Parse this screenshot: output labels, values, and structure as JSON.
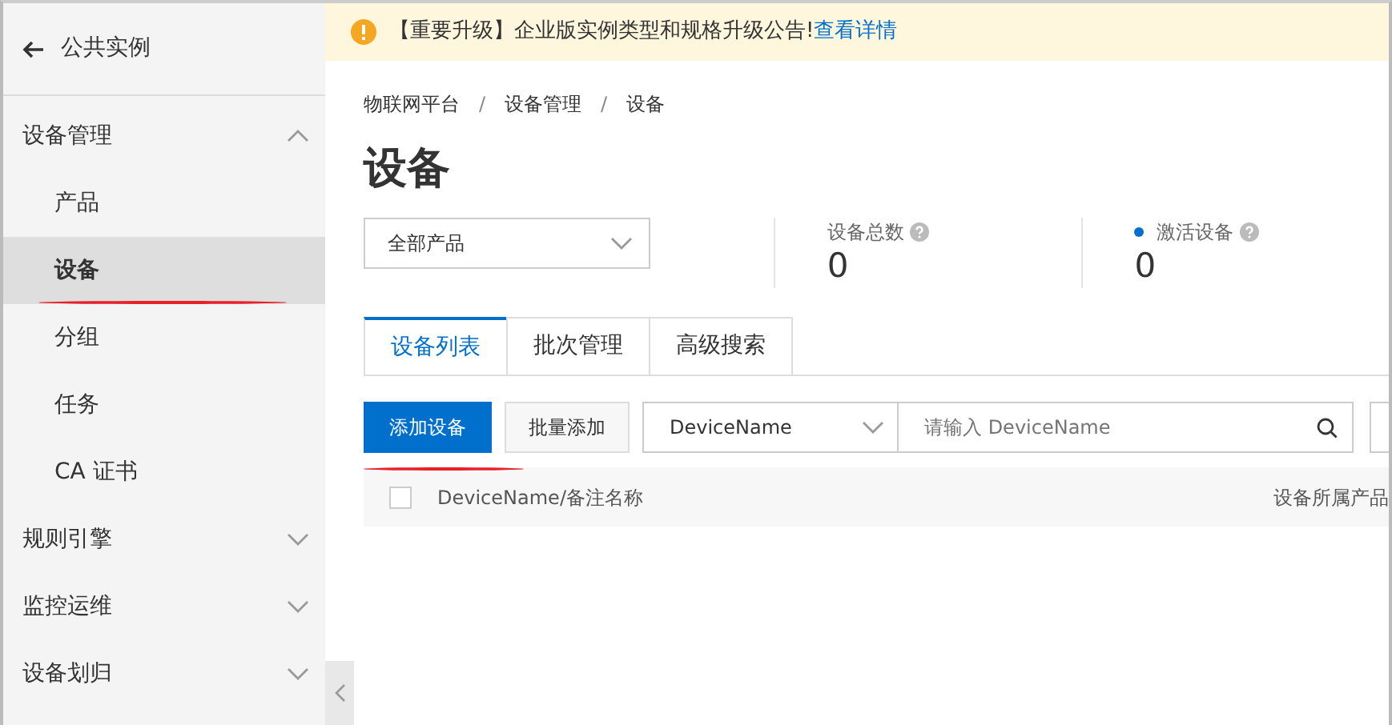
{
  "sidebar": {
    "back_label": "公共实例",
    "sections": [
      {
        "label": "设备管理",
        "expanded": true,
        "items": [
          {
            "label": "产品",
            "selected": false
          },
          {
            "label": "设备",
            "selected": true
          },
          {
            "label": "分组",
            "selected": false
          },
          {
            "label": "任务",
            "selected": false
          },
          {
            "label": "CA 证书",
            "selected": false
          }
        ]
      },
      {
        "label": "规则引擎",
        "expanded": false
      },
      {
        "label": "监控运维",
        "expanded": false
      },
      {
        "label": "设备划归",
        "expanded": false
      }
    ]
  },
  "notice": {
    "text": "【重要升级】企业版实例类型和规格升级公告!",
    "link": "查看详情"
  },
  "breadcrumb": {
    "separator": "/",
    "items": [
      "物联网平台",
      "设备管理",
      "设备"
    ]
  },
  "title": "设备",
  "product_select": {
    "value": "全部产品"
  },
  "stats": [
    {
      "label": "设备总数",
      "value": "0",
      "dot": false
    },
    {
      "label": "激活设备",
      "value": "0",
      "dot": true
    }
  ],
  "tabs": [
    {
      "label": "设备列表",
      "selected": true
    },
    {
      "label": "批次管理",
      "selected": false
    },
    {
      "label": "高级搜索",
      "selected": false
    }
  ],
  "toolbar": {
    "primary": "添加设备",
    "secondary": "批量添加",
    "field_select": "DeviceName",
    "search_placeholder": "请输入 DeviceName"
  },
  "table": {
    "select_all_checked": false,
    "columns": [
      "DeviceName/备注名称",
      "设备所属产品"
    ]
  }
}
